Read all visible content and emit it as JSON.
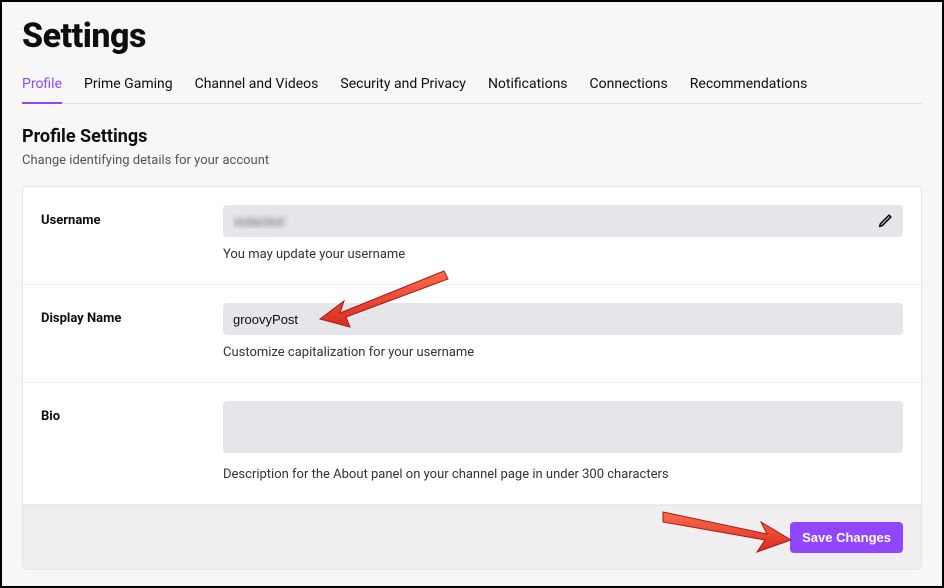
{
  "page": {
    "title": "Settings"
  },
  "tabs": [
    {
      "label": "Profile",
      "active": true
    },
    {
      "label": "Prime Gaming",
      "active": false
    },
    {
      "label": "Channel and Videos",
      "active": false
    },
    {
      "label": "Security and Privacy",
      "active": false
    },
    {
      "label": "Notifications",
      "active": false
    },
    {
      "label": "Connections",
      "active": false
    },
    {
      "label": "Recommendations",
      "active": false
    }
  ],
  "section": {
    "title": "Profile Settings",
    "subtitle": "Change identifying details for your account"
  },
  "fields": {
    "username": {
      "label": "Username",
      "value": "redacted",
      "hint": "You may update your username"
    },
    "displayName": {
      "label": "Display Name",
      "value": "groovyPost",
      "hint": "Customize capitalization for your username"
    },
    "bio": {
      "label": "Bio",
      "value": "",
      "hint": "Description for the About panel on your channel page in under 300 characters"
    }
  },
  "buttons": {
    "save": "Save Changes"
  }
}
